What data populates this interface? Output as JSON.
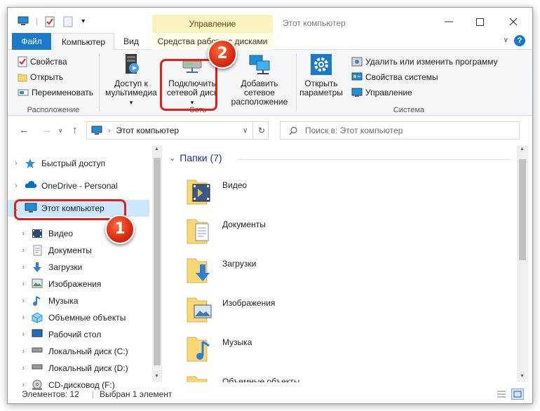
{
  "titlebar": {
    "manage_tab": "Управление",
    "window_title": "Этот компьютер"
  },
  "tabs": {
    "file": "Файл",
    "computer": "Компьютер",
    "view": "Вид",
    "drive_tools": "Средства работы с дисками"
  },
  "ribbon": {
    "location": {
      "label": "Расположение",
      "properties": "Свойства",
      "open": "Открыть",
      "rename": "Переименовать"
    },
    "network": {
      "label": "Сеть",
      "media_line1": "Доступ к",
      "media_line2": "мультимедиа",
      "map_drive_line1": "Подключить",
      "map_drive_line2": "сетевой диск",
      "add_location_line1": "Добавить сетевое",
      "add_location_line2": "расположение"
    },
    "system": {
      "label": "Система",
      "settings_line1": "Открыть",
      "settings_line2": "параметры",
      "uninstall": "Удалить или изменить программу",
      "system_props": "Свойства системы",
      "manage": "Управление"
    }
  },
  "address": {
    "path": "Этот компьютер",
    "search_placeholder": "Поиск в: Этот компьютер"
  },
  "nav": {
    "quick_access": "Быстрый доступ",
    "onedrive": "OneDrive - Personal",
    "this_pc": "Этот компьютер",
    "items": [
      "Видео",
      "Документы",
      "Загрузки",
      "Изображения",
      "Музыка",
      "Объемные объекты",
      "Рабочий стол",
      "Локальный диск (C:)",
      "Локальный диск (D:)",
      "CD-дисковод (F:)"
    ]
  },
  "content": {
    "group_title": "Папки (7)",
    "folders": [
      "Видео",
      "Документы",
      "Загрузки",
      "Изображения",
      "Музыка",
      "Объемные объекты"
    ]
  },
  "status": {
    "count": "Элементов: 12",
    "selected": "Выбран 1 элемент"
  },
  "callouts": {
    "badge1": "1",
    "badge2": "2"
  },
  "colors": {
    "accent": "#1979ca",
    "manage_tab_bg": "#fbf3bf",
    "selection": "#cce8ff",
    "callout_red": "#e0201b",
    "folder_yellow": "#f8d775"
  }
}
